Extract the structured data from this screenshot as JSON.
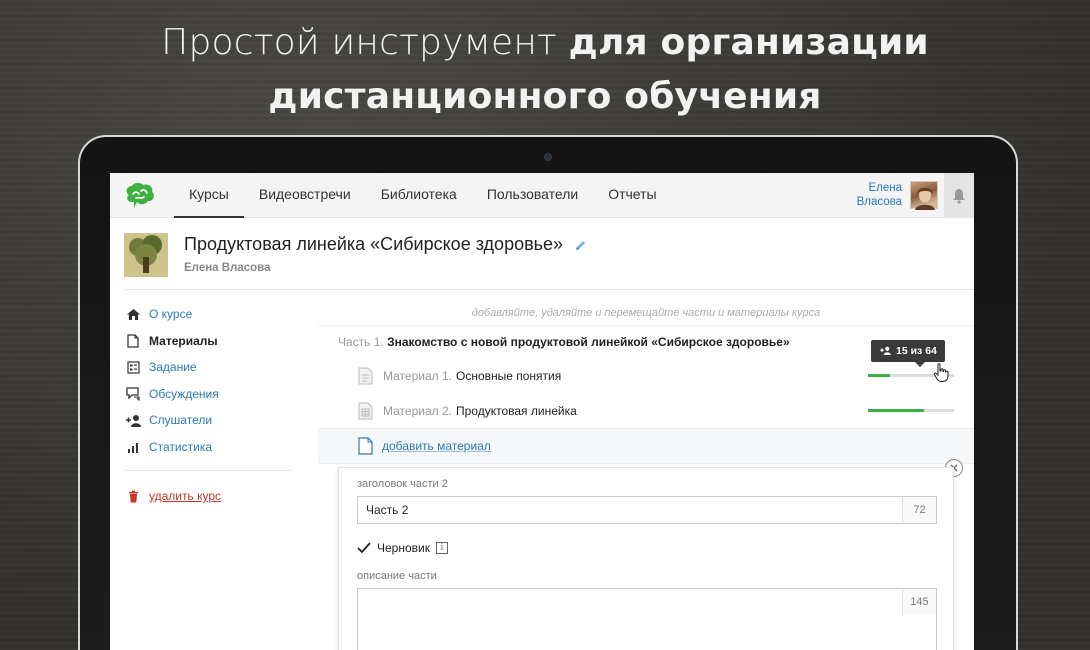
{
  "headline": {
    "light": "Простой инструмент",
    "bold_line1": "для организации",
    "bold_line2": "дистанционного обучения"
  },
  "topbar": {
    "nav": [
      {
        "label": "Курсы",
        "active": true
      },
      {
        "label": "Видеовстречи",
        "active": false
      },
      {
        "label": "Библиотека",
        "active": false
      },
      {
        "label": "Пользователи",
        "active": false
      },
      {
        "label": "Отчеты",
        "active": false
      }
    ],
    "user_first": "Елена",
    "user_last": "Власова"
  },
  "course": {
    "title": "Продуктовая линейка «Сибирское здоровье»",
    "author": "Елена Власова"
  },
  "sidebar": {
    "items": [
      {
        "label": "О курсе",
        "icon": "home-icon"
      },
      {
        "label": "Материалы",
        "icon": "document-icon"
      },
      {
        "label": "Задание",
        "icon": "task-icon"
      },
      {
        "label": "Обсуждения",
        "icon": "chat-icon"
      },
      {
        "label": "Слушатели",
        "icon": "add-user-icon"
      },
      {
        "label": "Статистика",
        "icon": "bar-chart-icon"
      }
    ],
    "delete_label": "удалить курс"
  },
  "main": {
    "hint": "добавляйте, удаляйте и перемещайте части и материалы курса",
    "part_prefix": "Часть 1.",
    "part_title": "Знакомство с новой продуктовой линейкой «Сибирское здоровье»",
    "materials": [
      {
        "prefix": "Материал 1.",
        "title": "Основные понятия",
        "progress": 0.25
      },
      {
        "prefix": "Материал 2.",
        "title": "Продуктовая линейка",
        "progress": 0.65
      }
    ],
    "tooltip": "15 из 64",
    "add_material": "добавить материал"
  },
  "form": {
    "title_label": "заголовок части 2",
    "title_value": "Часть 2",
    "title_count": "72",
    "draft_label": "Черновик",
    "draft_checked": true,
    "desc_label": "описание части",
    "desc_count": "145"
  },
  "colors": {
    "link": "#2a7ab8",
    "progress": "#3cb043",
    "danger": "#c0392b"
  }
}
